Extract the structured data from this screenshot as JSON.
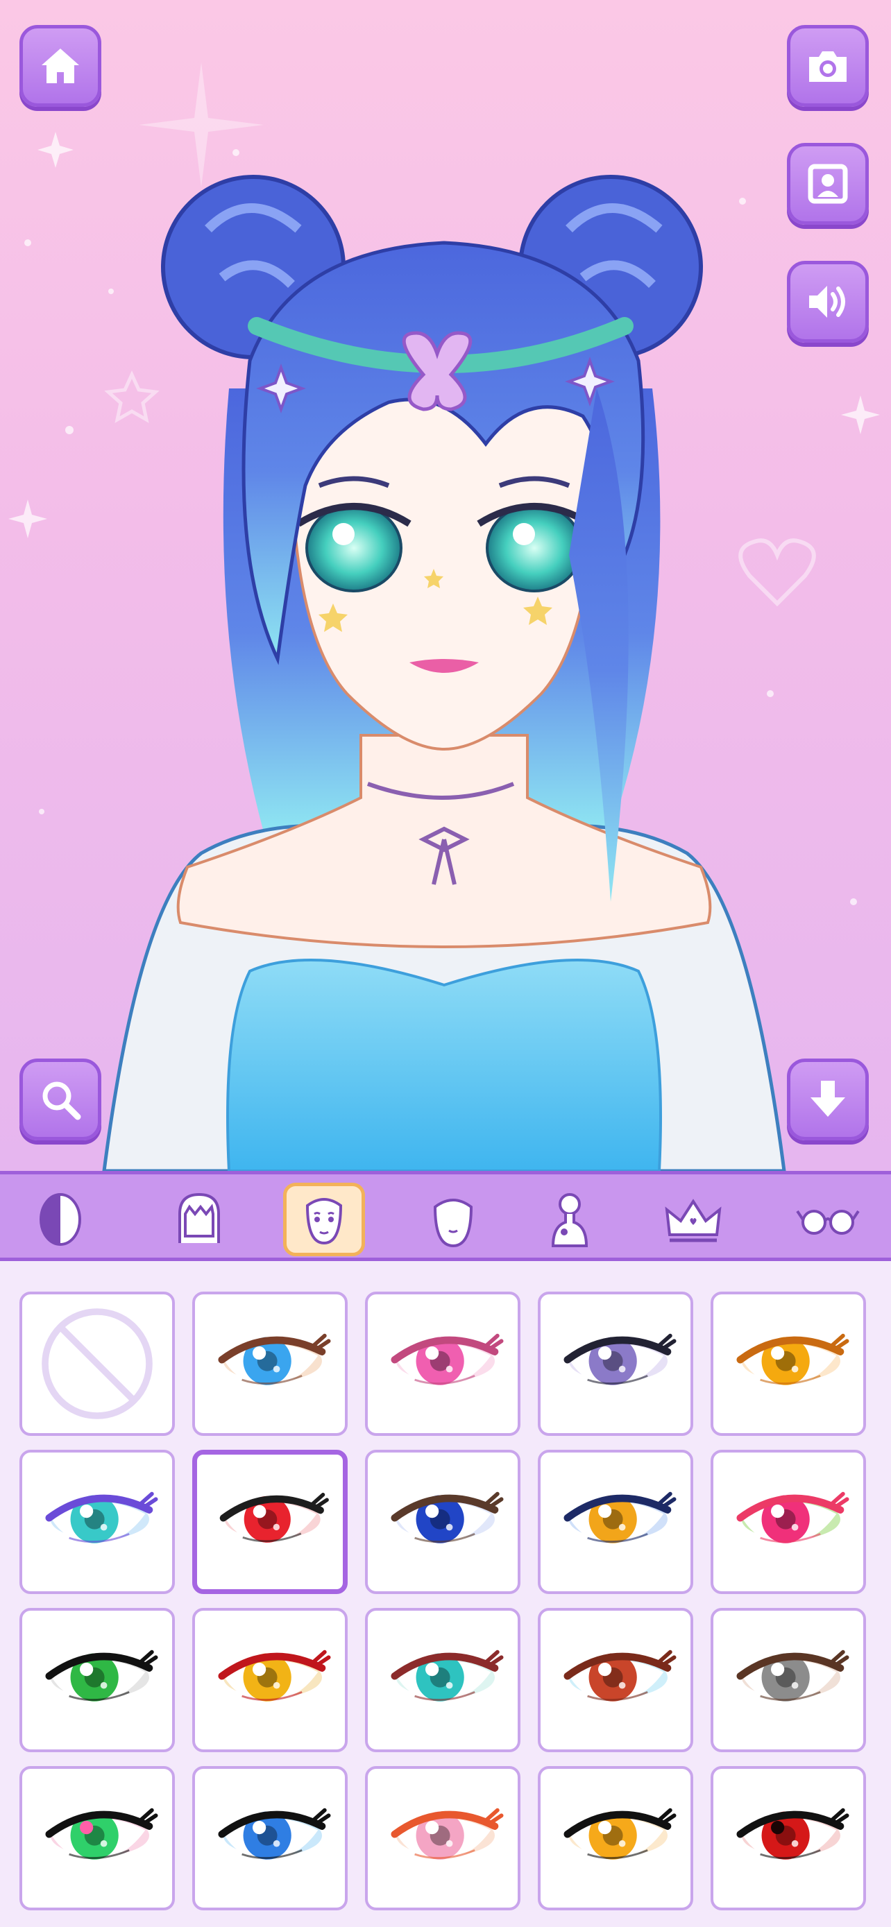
{
  "top_buttons": {
    "home": "home-icon",
    "camera": "camera-icon",
    "portrait": "portrait-icon",
    "sound": "speaker-icon",
    "zoom": "magnifier-icon",
    "download": "download-arrow-icon"
  },
  "tabs": [
    {
      "icon": "skin-tone-icon"
    },
    {
      "icon": "hair-icon"
    },
    {
      "icon": "face-icon",
      "active": true
    },
    {
      "icon": "head-shape-icon"
    },
    {
      "icon": "body-icon"
    },
    {
      "icon": "crown-icon"
    },
    {
      "icon": "glasses-icon"
    }
  ],
  "eye_options": [
    {
      "type": "none"
    },
    {
      "iris": "#3aa5ef",
      "lid": "#7a3f2a",
      "hl": "#ffffff",
      "shadow": "#f2c9a6"
    },
    {
      "iris": "#f05fb0",
      "lid": "#c2497e",
      "hl": "#ffffff",
      "shadow": "#f8c1dd"
    },
    {
      "iris": "#8b7ac8",
      "lid": "#222233",
      "hl": "#ffffff",
      "shadow": "#d4c8ef"
    },
    {
      "iris": "#f5a90f",
      "lid": "#c96a11",
      "hl": "#ffffff",
      "shadow": "#fbd3a0"
    },
    {
      "iris": "#38c9c8",
      "lid": "#6a4bd8",
      "hl": "#ffffff",
      "shadow": "#a9d5f6"
    },
    {
      "iris": "#e8232e",
      "lid": "#1d1d1d",
      "hl": "#ffffff",
      "shadow": "#f4b1b4",
      "selected": true
    },
    {
      "iris": "#2145c6",
      "lid": "#5a3a2a",
      "hl": "#ffffff",
      "shadow": "#c8d4f5"
    },
    {
      "iris": "#f2a51a",
      "lid": "#1d2a66",
      "hl": "#ffffff",
      "shadow": "#a9c6f4"
    },
    {
      "iris": "#f0307a",
      "lid": "#ec3a66",
      "hl": "#ffffff",
      "shadow": "#9ad86e"
    },
    {
      "iris": "#2fb845",
      "lid": "#111111",
      "hl": "#ffffff",
      "shadow": "#d0d0d0"
    },
    {
      "iris": "#f2b316",
      "lid": "#c0161c",
      "hl": "#ffffff",
      "shadow": "#f3d18b"
    },
    {
      "iris": "#2ec3c0",
      "lid": "#8c2b2b",
      "hl": "#ffffff",
      "shadow": "#c2ece6"
    },
    {
      "iris": "#c9452a",
      "lid": "#7a2a1a",
      "hl": "#ffffff",
      "shadow": "#a8e2f5"
    },
    {
      "iris": "#8c8c8c",
      "lid": "#5a3524",
      "hl": "#ffffff",
      "shadow": "#e3c7b7"
    },
    {
      "iris": "#2fd06a",
      "lid": "#111111",
      "hl": "#ff5fa8",
      "shadow": "#f6b5cf"
    },
    {
      "iris": "#2f7ee3",
      "lid": "#111111",
      "hl": "#ffffff",
      "shadow": "#9ed5f8"
    },
    {
      "iris": "#f4a5c4",
      "lid": "#e8582e",
      "hl": "#ffffff",
      "shadow": "#f8ccb3"
    },
    {
      "iris": "#f6a91a",
      "lid": "#111111",
      "hl": "#ffffff",
      "shadow": "#f9d7a4"
    },
    {
      "iris": "#d51818",
      "lid": "#111111",
      "hl": "#1a0505",
      "shadow": "#f1b0b0"
    }
  ]
}
